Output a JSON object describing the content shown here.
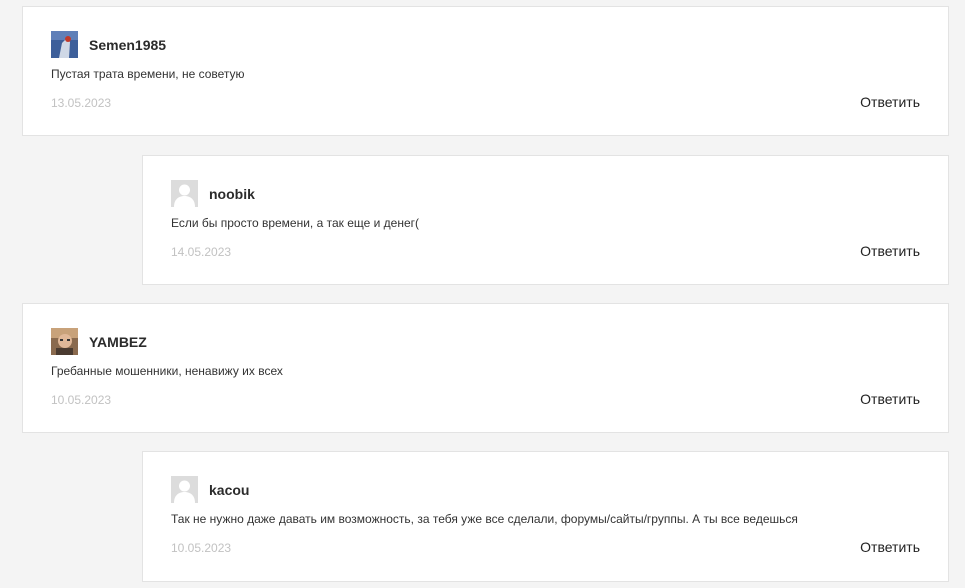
{
  "reply_label": "Ответить",
  "comments": [
    {
      "author": "Semen1985",
      "avatar": "user-photo-avatar",
      "text": "Пустая трата времени, не советую",
      "date": "13.05.2023"
    },
    {
      "author": "noobik",
      "avatar": "default-avatar",
      "text": "Если бы просто времени, а так еще и денег(",
      "date": "14.05.2023"
    },
    {
      "author": "YAMBEZ",
      "avatar": "user-photo-avatar",
      "text": "Гребанные мошенники, ненавижу их всех",
      "date": "10.05.2023"
    },
    {
      "author": "kacou",
      "avatar": "default-avatar",
      "text": "Так не нужно даже давать им возможность, за тебя уже все сделали, форумы/сайты/группы. А ты все ведешься",
      "date": "10.05.2023"
    }
  ]
}
